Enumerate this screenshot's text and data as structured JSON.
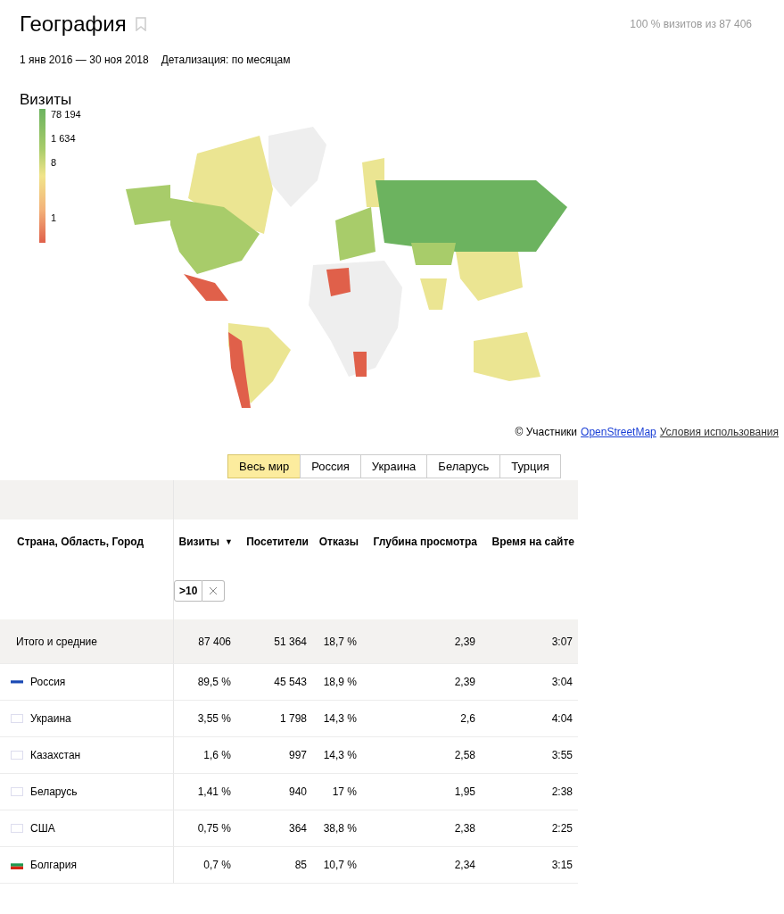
{
  "title": "География",
  "summary": "100 % визитов из 87 406",
  "period": "1 янв 2016 — 30 ноя 2018",
  "detail": "Детализация: по месяцам",
  "map": {
    "title": "Визиты",
    "legend": [
      "78 194",
      "1 634",
      "8",
      "1"
    ],
    "attribution": {
      "prefix": "© Участники",
      "link": "OpenStreetMap",
      "terms": "Условия использования"
    }
  },
  "tabs": [
    {
      "label": "Весь мир",
      "selected": true
    },
    {
      "label": "Россия",
      "selected": false
    },
    {
      "label": "Украина",
      "selected": false
    },
    {
      "label": "Беларусь",
      "selected": false
    },
    {
      "label": "Турция",
      "selected": false
    }
  ],
  "table": {
    "columns": [
      {
        "label": "Страна, Область, Город"
      },
      {
        "label": "Визиты",
        "sort_icon": "▼"
      },
      {
        "label": "Посетители"
      },
      {
        "label": "Отказы"
      },
      {
        "label": "Глубина просмотра"
      },
      {
        "label": "Время на сайте"
      }
    ],
    "filter": ">10",
    "totals": [
      "Итого и средние",
      "87 406",
      "51 364",
      "18,7 %",
      "2,39",
      "3:07"
    ],
    "rows": [
      {
        "kind": "russia",
        "cells": [
          "Россия",
          "89,5 %",
          "45 543",
          "18,9 %",
          "2,39",
          "3:04"
        ]
      },
      {
        "kind": "blank",
        "cells": [
          "Украина",
          "3,55 %",
          "1 798",
          "14,3 %",
          "2,6",
          "4:04"
        ]
      },
      {
        "kind": "blank",
        "cells": [
          "Казахстан",
          "1,6 %",
          "997",
          "14,3 %",
          "2,58",
          "3:55"
        ]
      },
      {
        "kind": "blank",
        "cells": [
          "Беларусь",
          "1,41 %",
          "940",
          "17 %",
          "1,95",
          "2:38"
        ]
      },
      {
        "kind": "blank",
        "cells": [
          "США",
          "0,75 %",
          "364",
          "38,8 %",
          "2,38",
          "2:25"
        ]
      },
      {
        "kind": "bulgaria",
        "cells": [
          "Болгария",
          "0,7 %",
          "85",
          "10,7 %",
          "2,34",
          "3:15"
        ]
      }
    ]
  }
}
